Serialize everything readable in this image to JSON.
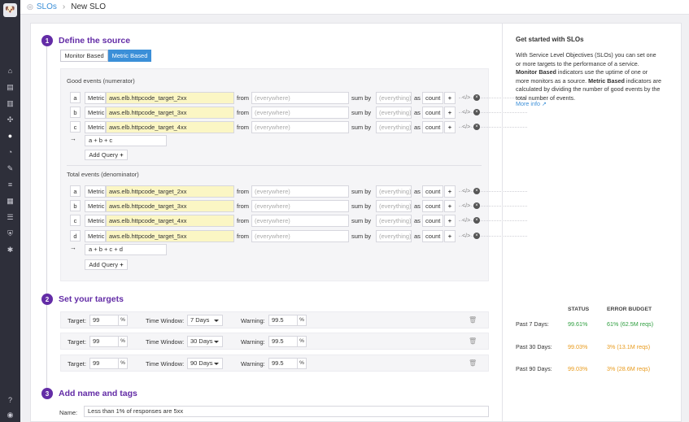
{
  "breadcrumb": {
    "parent": "SLOs",
    "current": "New SLO"
  },
  "colors": {
    "brand": "#632ca6",
    "accent": "#3b8fd8",
    "ok": "#2e9e3f",
    "warn": "#e89a1b"
  },
  "steps": [
    {
      "num": "1",
      "title": "Define the source"
    },
    {
      "num": "2",
      "title": "Set your targets"
    },
    {
      "num": "3",
      "title": "Add name and tags"
    }
  ],
  "source_toggle": {
    "monitor": "Monitor Based",
    "metric": "Metric Based",
    "selected": "Metric Based"
  },
  "good": {
    "label": "Good events (numerator)",
    "rows": [
      {
        "letter": "a",
        "metric_label": "Metric",
        "metric": "aws.elb.httpcode_target_2xx",
        "from_label": "from",
        "from": "(everywhere)",
        "sum_label": "sum by",
        "sum": "(everything)",
        "as_label": "as",
        "as": "count"
      },
      {
        "letter": "b",
        "metric_label": "Metric",
        "metric": "aws.elb.httpcode_target_3xx",
        "from_label": "from",
        "from": "(everywhere)",
        "sum_label": "sum by",
        "sum": "(everything)",
        "as_label": "as",
        "as": "count"
      },
      {
        "letter": "c",
        "metric_label": "Metric",
        "metric": "aws.elb.httpcode_target_4xx",
        "from_label": "from",
        "from": "(everywhere)",
        "sum_label": "sum by",
        "sum": "(everything)",
        "as_label": "as",
        "as": "count"
      }
    ],
    "formula": "a + b + c",
    "add_query": "Add Query"
  },
  "total": {
    "label": "Total events (denominator)",
    "rows": [
      {
        "letter": "a",
        "metric_label": "Metric",
        "metric": "aws.elb.httpcode_target_2xx",
        "from_label": "from",
        "from": "(everywhere)",
        "sum_label": "sum by",
        "sum": "(everything)",
        "as_label": "as",
        "as": "count"
      },
      {
        "letter": "b",
        "metric_label": "Metric",
        "metric": "aws.elb.httpcode_target_3xx",
        "from_label": "from",
        "from": "(everywhere)",
        "sum_label": "sum by",
        "sum": "(everything)",
        "as_label": "as",
        "as": "count"
      },
      {
        "letter": "c",
        "metric_label": "Metric",
        "metric": "aws.elb.httpcode_target_4xx",
        "from_label": "from",
        "from": "(everywhere)",
        "sum_label": "sum by",
        "sum": "(everything)",
        "as_label": "as",
        "as": "count"
      },
      {
        "letter": "d",
        "metric_label": "Metric",
        "metric": "aws.elb.httpcode_target_5xx",
        "from_label": "from",
        "from": "(everywhere)",
        "sum_label": "sum by",
        "sum": "(everything)",
        "as_label": "as",
        "as": "count"
      }
    ],
    "formula": "a + b + c + d",
    "add_query": "Add Query"
  },
  "targets": [
    {
      "target_label": "Target:",
      "target": "99",
      "pct": "%",
      "window_label": "Time Window:",
      "window": "7 Days",
      "warning_label": "Warning:",
      "warning": "99.5"
    },
    {
      "target_label": "Target:",
      "target": "99",
      "pct": "%",
      "window_label": "Time Window:",
      "window": "30 Days",
      "warning_label": "Warning:",
      "warning": "99.5"
    },
    {
      "target_label": "Target:",
      "target": "99",
      "pct": "%",
      "window_label": "Time Window:",
      "window": "90 Days",
      "warning_label": "Warning:",
      "warning": "99.5"
    }
  ],
  "name": {
    "label": "Name:",
    "value": "Less than 1% of responses are 5xx"
  },
  "help": {
    "title": "Get started with SLOs",
    "p1": "With Service Level Objectives (SLOs) you can set one or more targets to the performance of a service. ",
    "b1": "Monitor Based",
    "p2": " indicators use the uptime of one or more monitors as a source. ",
    "b2": "Metric Based",
    "p3": " indicators are calculated by dividing the number of good events by the total number of events.",
    "more": "More info"
  },
  "status_table": {
    "status_header": "STATUS",
    "budget_header": "ERROR BUDGET",
    "rows": [
      {
        "period": "Past 7 Days:",
        "status": "99.61%",
        "budget": "61% (62.5M reqs)",
        "status_color": "green",
        "budget_color": "green"
      },
      {
        "period": "Past 30 Days:",
        "status": "99.03%",
        "budget": "3% (13.1M reqs)",
        "status_color": "orange",
        "budget_color": "orange"
      },
      {
        "period": "Past 90 Days:",
        "status": "99.03%",
        "budget": "3% (28.6M reqs)",
        "status_color": "orange",
        "budget_color": "orange"
      }
    ]
  }
}
